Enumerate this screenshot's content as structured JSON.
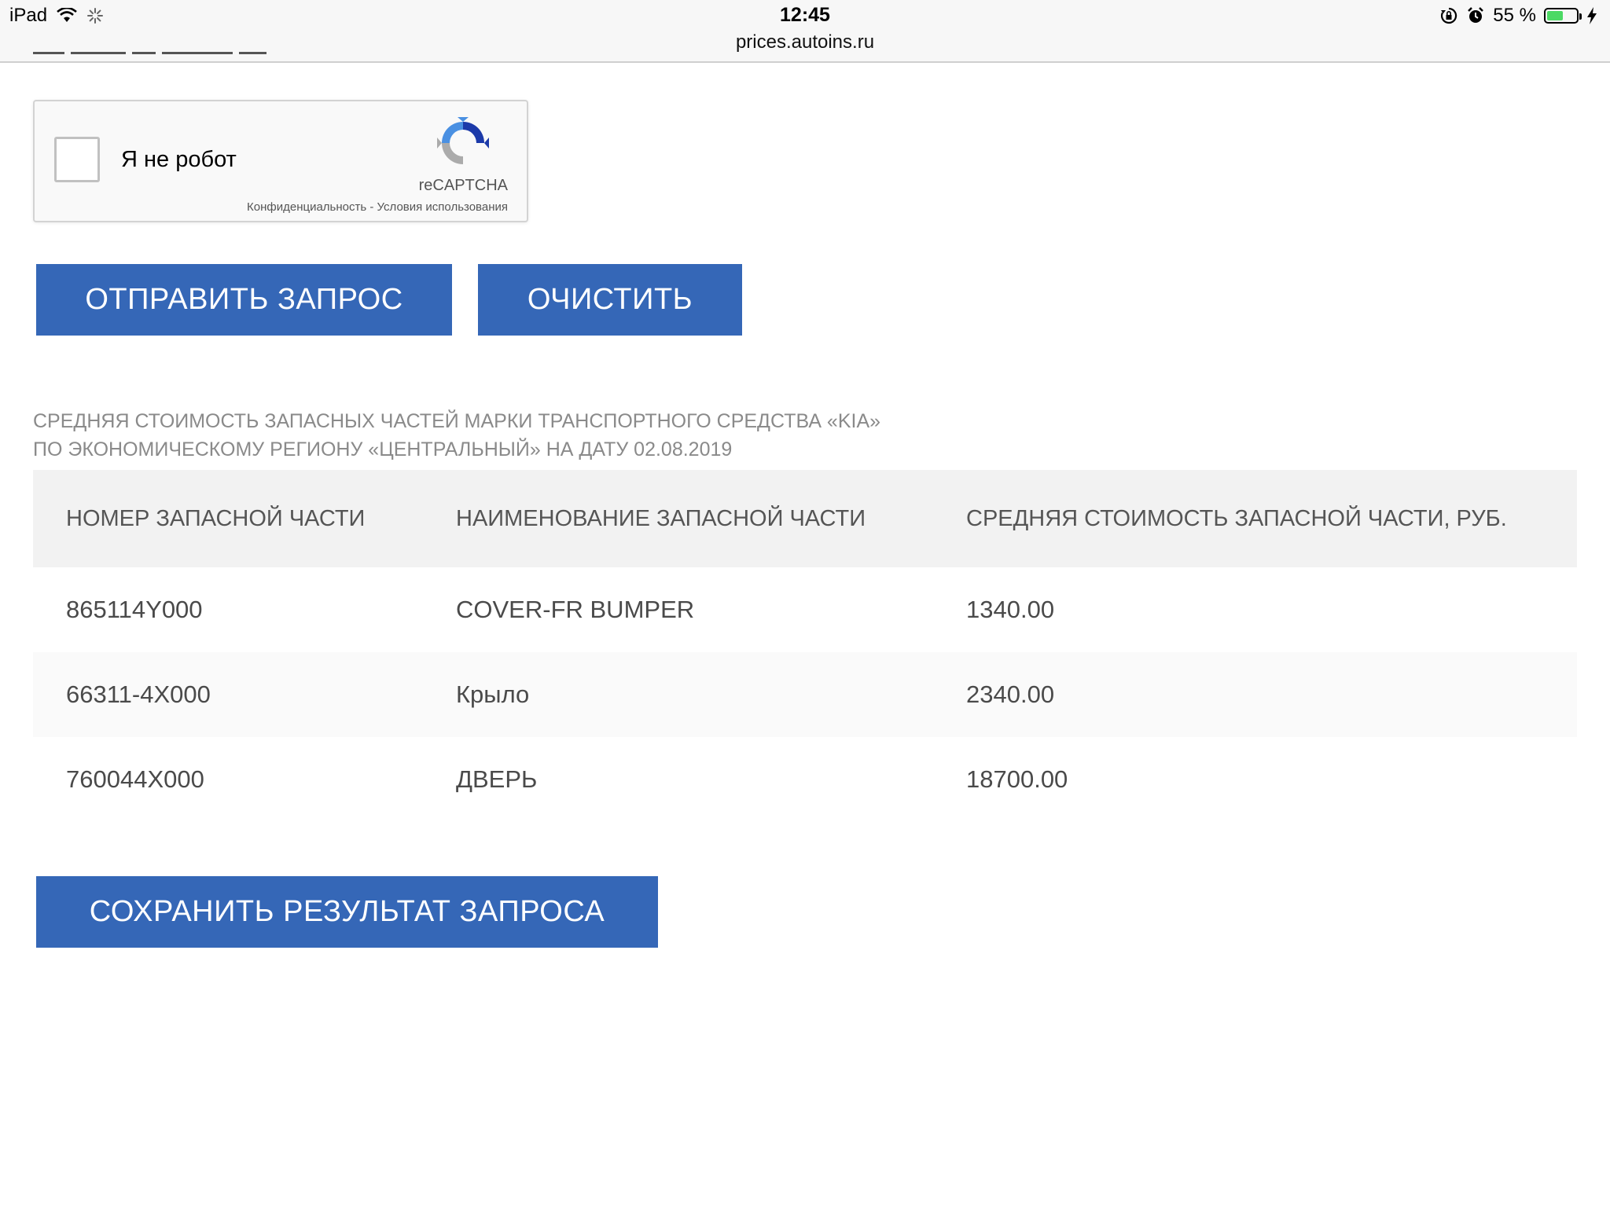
{
  "status_bar": {
    "device": "iPad",
    "time": "12:45",
    "url": "prices.autoins.ru",
    "battery_percent": "55 %",
    "battery_level": 0.55,
    "battery_color": "#4cd964"
  },
  "recaptcha": {
    "label": "Я не робот",
    "brand": "reCAPTCHA",
    "links": "Конфиденциальность - Условия использования"
  },
  "buttons": {
    "submit": "ОТПРАВИТЬ ЗАПРОС",
    "clear": "ОЧИСТИТЬ",
    "save": "СОХРАНИТЬ РЕЗУЛЬТАТ ЗАПРОСА"
  },
  "result": {
    "heading_line1": "СРЕДНЯЯ СТОИМОСТЬ ЗАПАСНЫХ ЧАСТЕЙ МАРКИ ТРАНСПОРТНОГО СРЕДСТВА «KIA»",
    "heading_line2": "ПО ЭКОНОМИЧЕСКОМУ РЕГИОНУ «ЦЕНТРАЛЬНЫЙ» НА ДАТУ 02.08.2019",
    "columns": [
      "НОМЕР ЗАПАСНОЙ ЧАСТИ",
      "НАИМЕНОВАНИЕ ЗАПАСНОЙ ЧАСТИ",
      "СРЕДНЯЯ СТОИМОСТЬ ЗАПАСНОЙ ЧАСТИ, РУБ."
    ],
    "rows": [
      [
        "865114Y000",
        "COVER-FR BUMPER",
        "1340.00"
      ],
      [
        "66311-4X000",
        "Крыло",
        "2340.00"
      ],
      [
        "760044X000",
        "ДВЕРЬ",
        "18700.00"
      ]
    ]
  },
  "colors": {
    "button_blue": "#3567b7",
    "heading_gray": "#8a8a8a",
    "table_header_bg": "#f2f2f2"
  }
}
